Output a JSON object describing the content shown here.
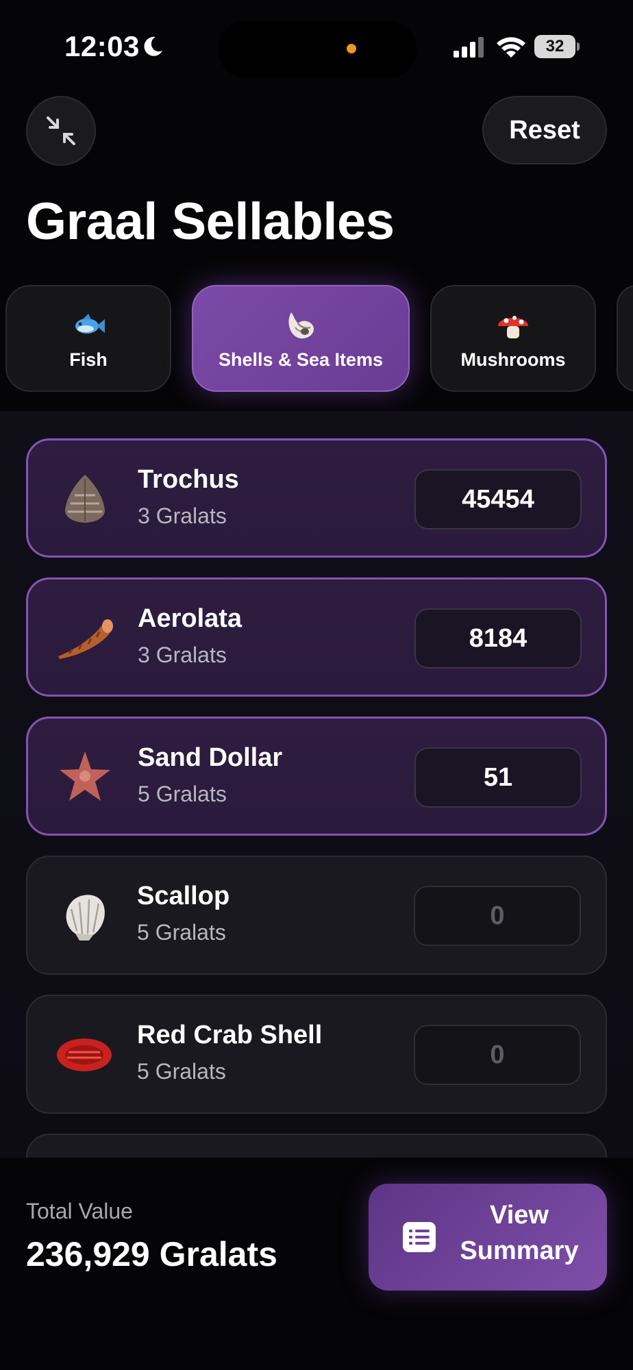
{
  "status_bar": {
    "time": "12:03",
    "battery": "32"
  },
  "header": {
    "reset_label": "Reset",
    "title": "Graal Sellables"
  },
  "tabs": [
    {
      "label": "Fish",
      "icon": "fish-icon",
      "active": false
    },
    {
      "label": "Shells & Sea Items",
      "icon": "shell-icon",
      "active": true
    },
    {
      "label": "Mushrooms",
      "icon": "mushroom-icon",
      "active": false
    }
  ],
  "items": [
    {
      "name": "Trochus",
      "price": "3 Gralats",
      "quantity": "45454",
      "icon": "trochus-shell-icon"
    },
    {
      "name": "Aerolata",
      "price": "3 Gralats",
      "quantity": "8184",
      "icon": "aerolata-shell-icon"
    },
    {
      "name": "Sand Dollar",
      "price": "5 Gralats",
      "quantity": "51",
      "icon": "starfish-icon"
    },
    {
      "name": "Scallop",
      "price": "5 Gralats",
      "quantity": "0",
      "icon": "scallop-shell-icon"
    },
    {
      "name": "Red Crab Shell",
      "price": "5 Gralats",
      "quantity": "0",
      "icon": "red-crab-shell-icon"
    }
  ],
  "footer": {
    "total_label": "Total Value",
    "total_value": "236,929 Gralats",
    "summary_button_label": "View Summary"
  },
  "colors": {
    "accent": "#7c4aa8",
    "accent_border": "#8454b5",
    "background": "#050507",
    "camera_dot": "#f2932b"
  }
}
